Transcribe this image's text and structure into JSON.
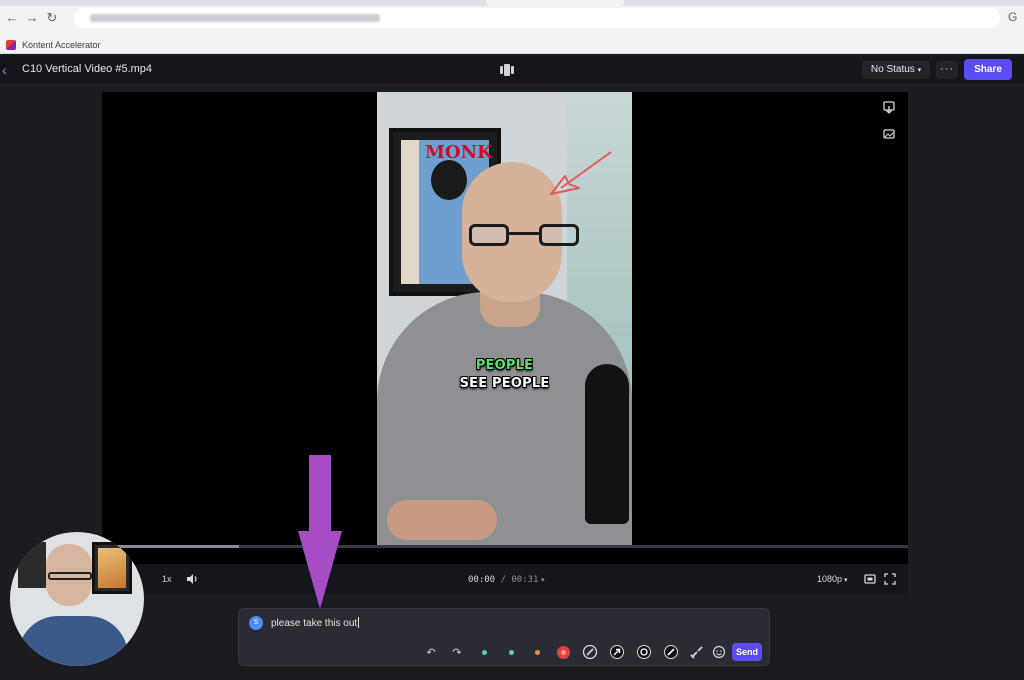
{
  "browser": {
    "bookmark_label": "Kontent Accelerator"
  },
  "header": {
    "back_glyph": "‹",
    "file_title": "C10 Vertical Video #5.mp4",
    "status_label": "No Status",
    "more_label": "···",
    "share_label": "Share"
  },
  "video": {
    "caption_line1": "PEOPLE",
    "caption_line2": "SEE PEOPLE",
    "progress_fraction": 0.17
  },
  "controls": {
    "speed_label": "1x",
    "time_current": "00:00",
    "time_separator": " / ",
    "time_total": "00:31",
    "quality_label": "1080p"
  },
  "comment": {
    "avatar_initial": "S",
    "text": "please take this out",
    "send_label": "Send",
    "tool_colors": [
      "#4fd1c5",
      "#4fd1c5",
      "#f08a4b",
      "#e53e3e"
    ]
  },
  "colors": {
    "accent": "#5b4df3",
    "annotation_arrow": "#e05a5a",
    "overlay_arrow": "#a64cc4",
    "caption_green": "#58e06b"
  }
}
